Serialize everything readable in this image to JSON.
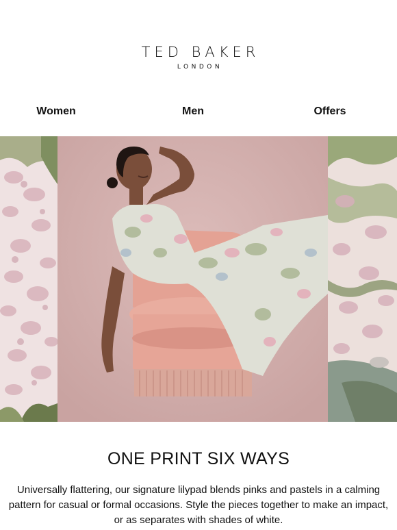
{
  "brand": {
    "name": "TED BAKER",
    "subtitle": "LONDON"
  },
  "nav": {
    "items": [
      {
        "label": "Women"
      },
      {
        "label": "Men"
      },
      {
        "label": "Offers"
      }
    ]
  },
  "hero": {
    "image": "model-in-floral-dress-on-pink-velvet-chair",
    "side_panels": "floral-print-detail"
  },
  "content": {
    "headline": "ONE PRINT SIX WAYS",
    "body": "Universally flattering, our signature lilypad blends pinks and pastels in a calming pattern for casual or formal occasions. Style the pieces together to make an impact, or as separates with shades of white."
  },
  "colors": {
    "background": "#ffffff",
    "text": "#111111",
    "backdrop_pink": "#d9b3b0",
    "chair_pink": "#e2a79a"
  }
}
